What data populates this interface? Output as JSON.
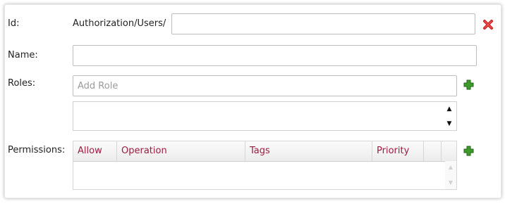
{
  "form": {
    "id": {
      "label": "Id:",
      "prefix": "Authorization/Users/",
      "value": ""
    },
    "name": {
      "label": "Name:",
      "value": ""
    },
    "roles": {
      "label": "Roles:",
      "placeholder": "Add Role"
    },
    "permissions": {
      "label": "Permissions:",
      "columns": [
        "Allow",
        "Operation",
        "Tags",
        "Priority"
      ]
    }
  },
  "icons": {
    "delete": "close-x-icon",
    "add_role": "plus-icon",
    "add_permission": "plus-icon",
    "scroll_up": "triangle-up-icon",
    "scroll_down": "triangle-down-icon"
  },
  "colors": {
    "column_header_text": "#9b1c3f",
    "delete_icon": "#cc1f1f",
    "add_icon": "#3d9b2a"
  }
}
